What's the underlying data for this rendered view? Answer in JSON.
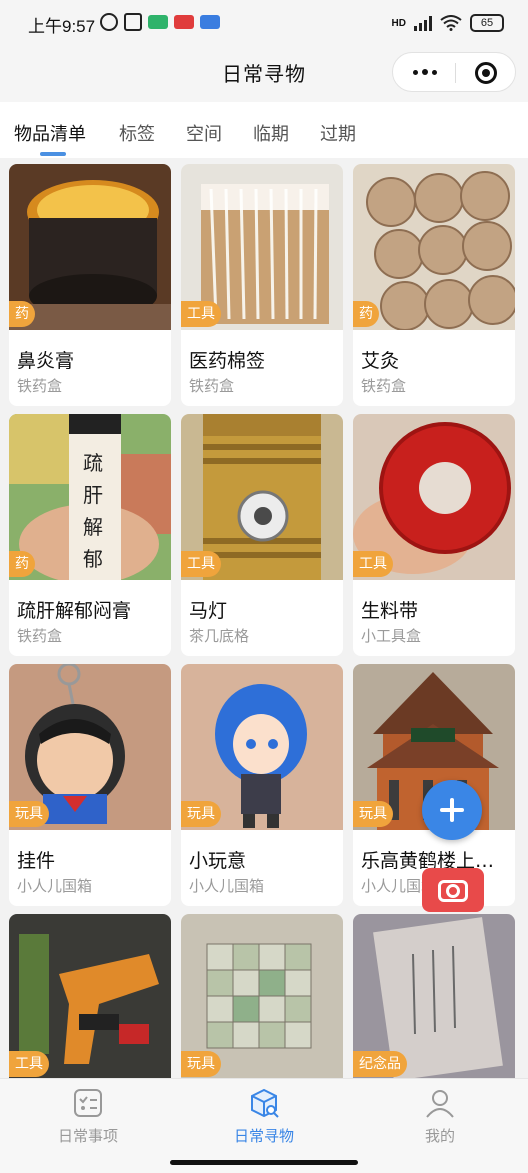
{
  "status": {
    "time": "上午9:57",
    "carrier": "HD",
    "battery": "65"
  },
  "nav": {
    "title": "日常寻物"
  },
  "tabs": [
    {
      "label": "物品清单"
    },
    {
      "label": "标签"
    },
    {
      "label": "空间"
    },
    {
      "label": "临期"
    },
    {
      "label": "过期"
    }
  ],
  "items": [
    {
      "name": "鼻炎膏",
      "location": "铁药盒",
      "tag": "药",
      "tag_color": "#f0a43c"
    },
    {
      "name": "医药棉签",
      "location": "铁药盒",
      "tag": "工具",
      "tag_color": "#f0a43c"
    },
    {
      "name": "艾灸",
      "location": "铁药盒",
      "tag": "药",
      "tag_color": "#f0a43c"
    },
    {
      "name": "疏肝解郁闷膏",
      "location": "铁药盒",
      "tag": "药",
      "tag_color": "#f0a43c"
    },
    {
      "name": "马灯",
      "location": "茶几底格",
      "tag": "工具",
      "tag_color": "#f0a43c"
    },
    {
      "name": "生料带",
      "location": "小工具盒",
      "tag": "工具",
      "tag_color": "#f0a43c"
    },
    {
      "name": "挂件",
      "location": "小人儿国箱",
      "tag": "玩具",
      "tag_color": "#f0a43c"
    },
    {
      "name": "小玩意",
      "location": "小人儿国箱",
      "tag": "玩具",
      "tag_color": "#f0a43c"
    },
    {
      "name": "乐高黄鹤楼上…",
      "location": "小人儿国箱",
      "tag": "玩具",
      "tag_color": "#f0a43c"
    },
    {
      "name": "",
      "location": "",
      "tag": "工具",
      "tag_color": "#f0a43c"
    },
    {
      "name": "",
      "location": "",
      "tag": "玩具",
      "tag_color": "#f0a43c"
    },
    {
      "name": "",
      "location": "",
      "tag": "纪念品",
      "tag_color": "#f0a43c"
    }
  ],
  "tabbar": [
    {
      "label": "日常事项",
      "icon": "checklist-icon"
    },
    {
      "label": "日常寻物",
      "icon": "box-search-icon"
    },
    {
      "label": "我的",
      "icon": "person-icon"
    }
  ],
  "colors": {
    "accent": "#3a86e6",
    "tag": "#f0a43c",
    "camera": "#e84a4a"
  }
}
